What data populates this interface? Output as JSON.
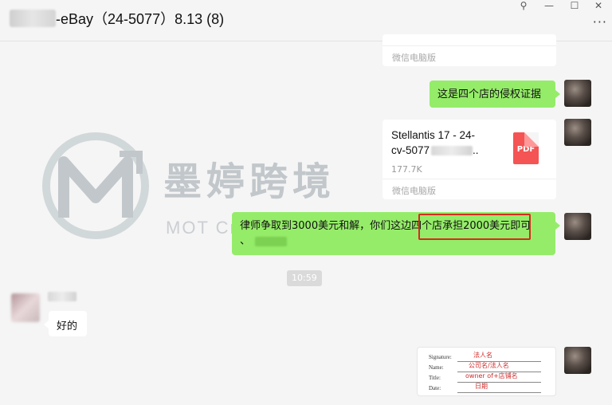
{
  "window": {
    "title": "-eBay（24-5077）8.13 (8)",
    "controls": {
      "pin": "⚲",
      "minimize": "—",
      "maximize": "☐",
      "close": "✕",
      "more": "···"
    }
  },
  "watermark": {
    "brand_cn": "墨婷跨境",
    "brand_en": "MOT Cross-boarding"
  },
  "messages": {
    "card_top": {
      "source": "微信电脑版"
    },
    "msg1": {
      "text": "这是四个店的侵权证据"
    },
    "file": {
      "name_line1": "Stellantis 17 - 24-",
      "name_line2": "cv-5077",
      "name_suffix": "..",
      "size": "177.7K",
      "type_badge": "PDF",
      "source": "微信电脑版"
    },
    "msg2": {
      "text_part1": "律师争取到3000美元和解，你们这边",
      "text_highlight": "四个店承担2000美元",
      "text_part2": "即可",
      "text_line2": "、"
    },
    "timestamp": "10:59",
    "reply": {
      "text": "好的"
    },
    "signature_card": {
      "rows": [
        {
          "label": "Signature:",
          "value": "法人名"
        },
        {
          "label": "Name:",
          "value": "公司名/法人名"
        },
        {
          "label": "Title:",
          "value": "owner of+店铺名"
        },
        {
          "label": "Date:",
          "value": "日期"
        }
      ]
    }
  },
  "colors": {
    "sent_bubble": "#95ec69",
    "received_bubble": "#ffffff",
    "highlight_box": "#d62b1f",
    "pdf_badge": "#f45454"
  }
}
